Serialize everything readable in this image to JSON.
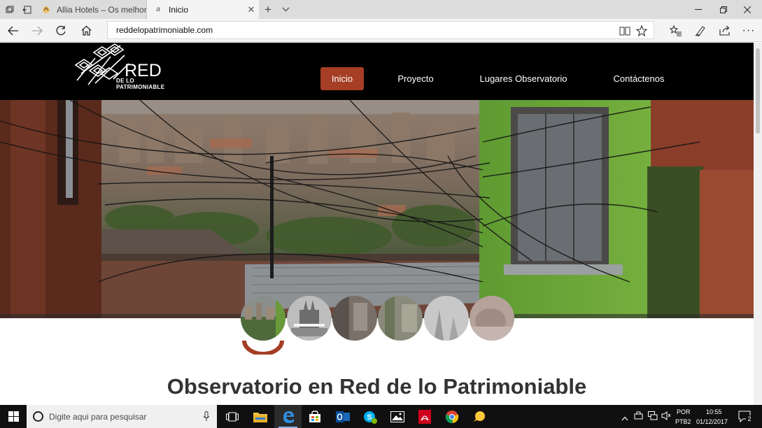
{
  "browser": {
    "tabs": [
      {
        "label": "Allia Hotels – Os melhores h",
        "active": false
      },
      {
        "label": "Inicio",
        "active": true
      }
    ],
    "new_tab": "+",
    "tab_list": "⌄",
    "url": "reddelopatrimoniable.com"
  },
  "site": {
    "logo": {
      "title": "RED",
      "subtitle": "DE LO PATRIMONIABLE"
    },
    "menu": [
      {
        "label": "Inicio",
        "active": true
      },
      {
        "label": "Proyecto",
        "active": false
      },
      {
        "label": "Lugares Observatorio",
        "active": false
      },
      {
        "label": "Contáctenos",
        "active": false
      }
    ],
    "slider": {
      "count": 6,
      "active_index": 0
    },
    "heading": "Observatorio en Red de lo Patrimoniable"
  },
  "taskbar": {
    "search_placeholder": "Digite aqui para pesquisar",
    "language": "POR",
    "keyboard": "PTB2",
    "time": "10:55",
    "date": "01/12/2017",
    "notifications": "2"
  },
  "colors": {
    "accent": "#a53e24",
    "header_bg": "#000000",
    "taskbar_bg": "#101010"
  }
}
